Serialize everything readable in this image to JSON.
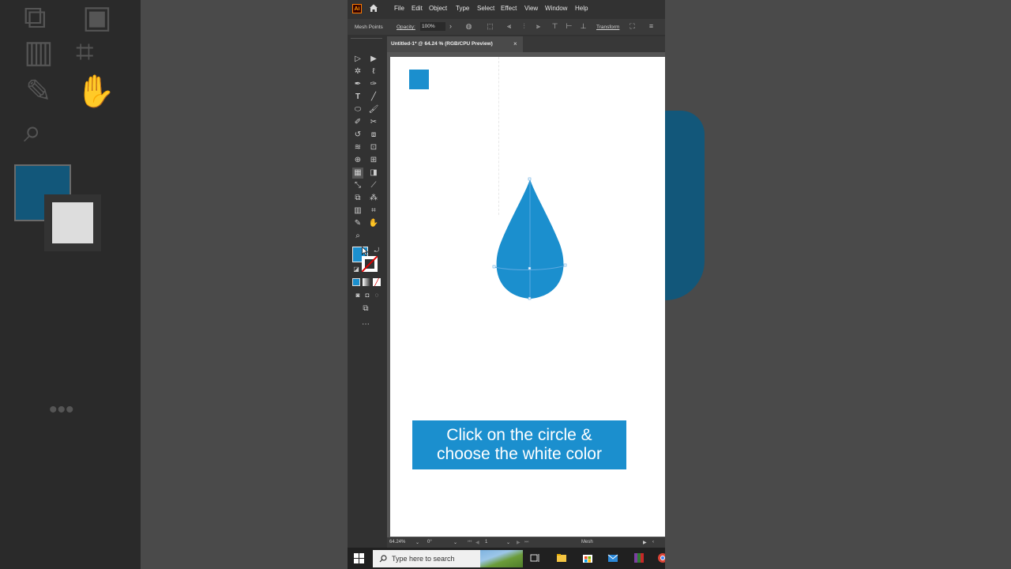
{
  "app": {
    "logo": "Ai",
    "menu": [
      "File",
      "Edit",
      "Object",
      "Type",
      "Select",
      "Effect",
      "View",
      "Window",
      "Help"
    ]
  },
  "control_bar": {
    "mode_label": "Mesh Points",
    "opacity_label": "Opacity:",
    "opacity_value": "100%",
    "transform_label": "Transform"
  },
  "document": {
    "tab_title": "Untitled-1* @ 64.24 % (RGB/CPU Preview)",
    "close_glyph": "×"
  },
  "artwork": {
    "fill_color": "#1b8fce",
    "caption_line1": "Click on the circle &",
    "caption_line2": "choose the white color"
  },
  "status_bar": {
    "zoom": "64.24%",
    "rotation": "0°",
    "artboard_number": "1",
    "tool_name": "Mesh"
  },
  "taskbar": {
    "search_placeholder": "Type here to search"
  }
}
